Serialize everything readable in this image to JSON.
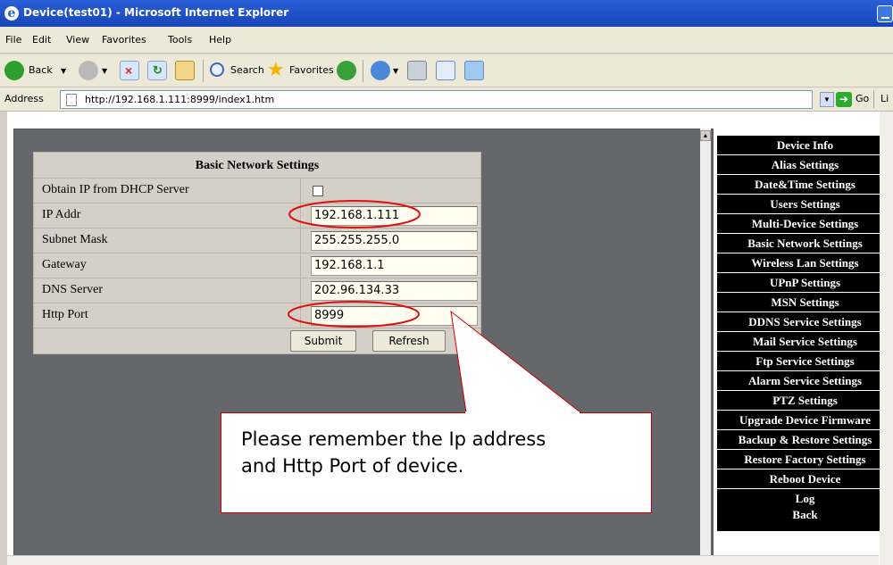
{
  "window": {
    "title": "Device(test01) - Microsoft Internet Explorer"
  },
  "menu": [
    "File",
    "Edit",
    "View",
    "Favorites",
    "Tools",
    "Help"
  ],
  "toolbar": {
    "back": "Back",
    "search": "Search",
    "favorites": "Favorites"
  },
  "address": {
    "label": "Address",
    "url": "http://192.168.1.111:8999/index1.htm",
    "go": "Go",
    "links": "Li"
  },
  "form": {
    "title": "Basic Network Settings",
    "rows": [
      {
        "label": "Obtain IP from DHCP Server",
        "type": "checkbox",
        "checked": false
      },
      {
        "label": "IP Addr",
        "value": "192.168.1.111"
      },
      {
        "label": "Subnet Mask",
        "value": "255.255.255.0"
      },
      {
        "label": "Gateway",
        "value": "192.168.1.1"
      },
      {
        "label": "DNS Server",
        "value": "202.96.134.33"
      },
      {
        "label": "Http Port",
        "value": "8999"
      }
    ],
    "submit": "Submit",
    "refresh": "Refresh"
  },
  "callout": {
    "line1": "Please remember the Ip address",
    "line2": "and Http Port of device."
  },
  "sidenav": [
    "Device Info",
    "Alias Settings",
    "Date&Time Settings",
    "Users Settings",
    "Multi-Device Settings",
    "Basic Network Settings",
    "Wireless Lan Settings",
    "UPnP Settings",
    "MSN Settings",
    "DDNS Service Settings",
    "Mail Service Settings",
    "Ftp Service Settings",
    "Alarm Service Settings",
    "PTZ Settings",
    "Upgrade Device Firmware",
    "Backup & Restore Settings",
    "Restore Factory Settings",
    "Reboot Device",
    "Log",
    "Back"
  ],
  "colors": {
    "highlight_ellipse": "#e01010",
    "nav_bg": "#000000",
    "frame_bg": "#66676b"
  }
}
